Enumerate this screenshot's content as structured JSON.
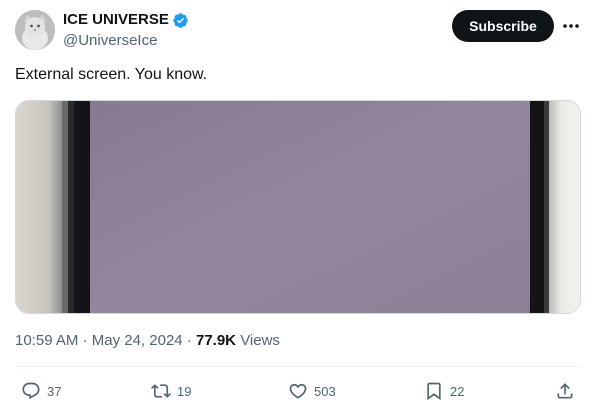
{
  "author": {
    "name": "ICE UNIVERSE",
    "handle": "@UniverseIce",
    "verified": true,
    "avatar_icon": "cat-avatar"
  },
  "header": {
    "subscribe_label": "Subscribe",
    "more_icon": "more-horizontal-icon"
  },
  "tweet": {
    "text": "External screen. You know."
  },
  "media": {
    "description_icon": "phone-screen-photo",
    "screen_color": "#8f8499"
  },
  "meta": {
    "time": "10:59 AM",
    "separator": "·",
    "date": "May 24, 2024",
    "views_count": "77.9K",
    "views_label": "Views"
  },
  "actions": {
    "replies": "37",
    "reposts": "19",
    "likes": "503",
    "bookmarks": "22"
  },
  "colors": {
    "verified": "#1d9bf0",
    "secondary_text": "#536471",
    "primary_text": "#0f1419",
    "button_bg": "#0f1419"
  }
}
